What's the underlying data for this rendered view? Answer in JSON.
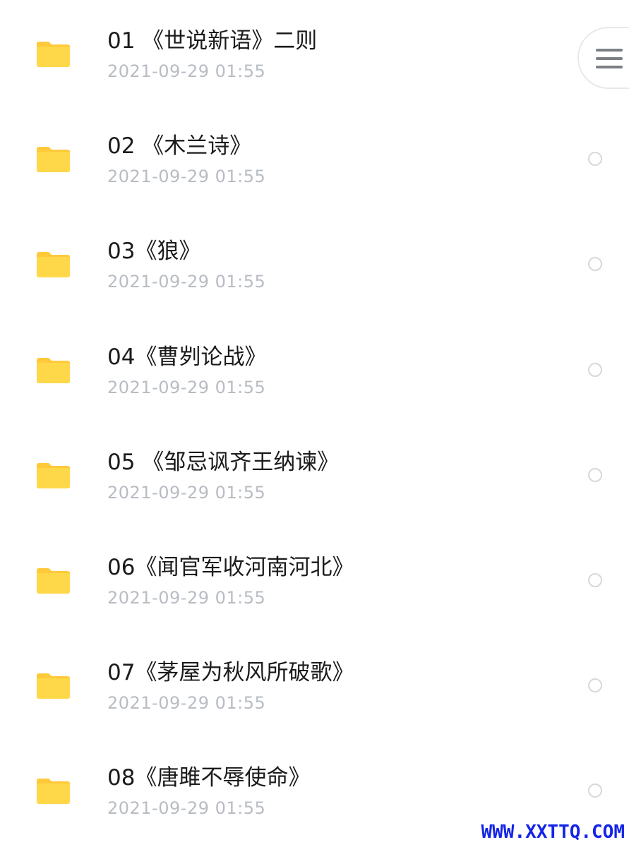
{
  "files": [
    {
      "title": "01 《世说新语》二则",
      "date": "2021-09-29 01:55",
      "icon": "folder-icon"
    },
    {
      "title": "02 《木兰诗》",
      "date": "2021-09-29 01:55",
      "icon": "folder-icon"
    },
    {
      "title": "03《狼》",
      "date": "2021-09-29 01:55",
      "icon": "folder-icon"
    },
    {
      "title": "04《曹刿论战》",
      "date": "2021-09-29 01:55",
      "icon": "folder-icon"
    },
    {
      "title": "05 《邹忌讽齐王纳谏》",
      "date": "2021-09-29 01:55",
      "icon": "folder-icon"
    },
    {
      "title": "06《闻官军收河南河北》",
      "date": "2021-09-29 01:55",
      "icon": "folder-icon"
    },
    {
      "title": "07《茅屋为秋风所破歌》",
      "date": "2021-09-29 01:55",
      "icon": "folder-icon"
    },
    {
      "title": "08《唐雎不辱使命》",
      "date": "2021-09-29 01:55",
      "icon": "folder-icon"
    }
  ],
  "menu_button": {
    "icon": "menu-icon"
  },
  "watermark": "WWW.XXTTQ.COM",
  "colors": {
    "folder": "#FFD84A",
    "folder_tab": "#FFC93A",
    "title": "#1B1B1B",
    "date": "#B8BCC3",
    "radio_border": "#D6D8DC",
    "watermark": "#1424E8"
  }
}
